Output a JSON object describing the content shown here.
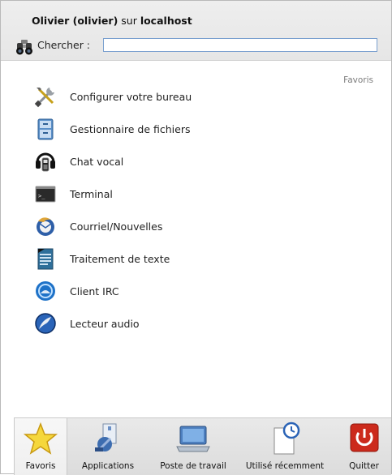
{
  "header": {
    "user_name": "Olivier (olivier)",
    "user_sep": " sur ",
    "host": "localhost",
    "search_label": "Chercher :",
    "search_value": "",
    "search_placeholder": ""
  },
  "section_label": "Favoris",
  "favorites": [
    {
      "label": "Configurer votre bureau",
      "icon": "tools-icon"
    },
    {
      "label": "Gestionnaire de fichiers",
      "icon": "file-manager-icon"
    },
    {
      "label": "Chat vocal",
      "icon": "headset-phone-icon"
    },
    {
      "label": "Terminal",
      "icon": "terminal-icon"
    },
    {
      "label": "Courriel/Nouvelles",
      "icon": "thunderbird-icon"
    },
    {
      "label": "Traitement de texte",
      "icon": "word-processor-icon"
    },
    {
      "label": "Client IRC",
      "icon": "irc-client-icon"
    },
    {
      "label": "Lecteur audio",
      "icon": "audio-player-icon"
    }
  ],
  "tabs": [
    {
      "label": "Favoris",
      "icon": "star-icon",
      "active": true
    },
    {
      "label": "Applications",
      "icon": "applications-icon",
      "active": false
    },
    {
      "label": "Poste de travail",
      "icon": "laptop-icon",
      "active": false
    },
    {
      "label": "Utilisé récemment",
      "icon": "recent-document-clock-icon",
      "active": false
    },
    {
      "label": "Quitter",
      "icon": "power-icon",
      "active": false
    }
  ],
  "colors": {
    "search_border": "#7aa0cf",
    "power_red": "#cc2a1c",
    "star_yellow": "#f5d73c"
  }
}
